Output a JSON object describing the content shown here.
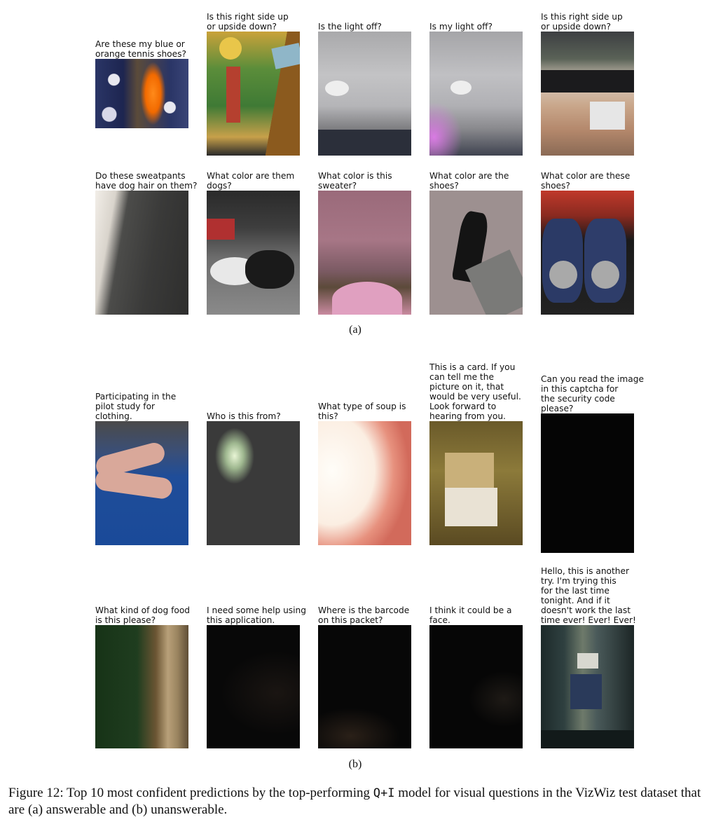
{
  "section_a": {
    "label": "(a)",
    "items": [
      {
        "question": "Are these my blue or\norange tennis shoes?",
        "image": "photo-blue-orange-shoes"
      },
      {
        "question": "Is this right side up\nor upside down?",
        "image": "photo-tarot-card"
      },
      {
        "question": "Is the light off?",
        "image": "photo-ceiling-fan"
      },
      {
        "question": "Is my light off?",
        "image": "photo-ceiling-fan-purple"
      },
      {
        "question": "Is this right side up\nor upside down?",
        "image": "photo-card-reader"
      },
      {
        "question": "Do these sweatpants\nhave dog hair on them?",
        "image": "photo-sweatpants"
      },
      {
        "question": "What color are them\ndogs?",
        "image": "photo-dogs"
      },
      {
        "question": "What color is this\nsweater?",
        "image": "photo-sweater"
      },
      {
        "question": "What color are the\nshoes?",
        "image": "photo-black-shoe"
      },
      {
        "question": "What color are these\nshoes?",
        "image": "photo-slippers"
      }
    ]
  },
  "section_b": {
    "label": "(b)",
    "items": [
      {
        "question": "Participating in the\npilot study for\nclothing.",
        "image": "photo-hand-peace"
      },
      {
        "question": "Who is this from?",
        "image": "photo-blurry-glow"
      },
      {
        "question": "What type of soup is\nthis?",
        "image": "photo-overexposed-pink"
      },
      {
        "question": "This is a card. If you\ncan tell me the\npicture on it, that\nwould be very useful.\nLook forward to\nhearing from you.",
        "image": "photo-blurry-card"
      },
      {
        "question": "Can you read the image\nin this captcha for\nthe security code\nplease?",
        "image": "photo-black"
      },
      {
        "question": "What kind of dog food\nis this please?",
        "image": "photo-blurry-green"
      },
      {
        "question": "I need some help using\nthis application.",
        "image": "photo-dark"
      },
      {
        "question": "Where is the barcode\non this packet?",
        "image": "photo-dark-2"
      },
      {
        "question": "I think it could be a\nface.",
        "image": "photo-dark-3"
      },
      {
        "question": "Hello, this is another\ntry. I'm trying this\nfor the last time\ntonight. And if it\ndoesn't work the last\ntime ever! Ever! Ever!",
        "image": "photo-hallway"
      }
    ]
  },
  "caption": {
    "prefix": "Figure 12: Top 10 most confident predictions by the top-performing ",
    "model": "Q+I",
    "suffix": " model for visual questions in the VizWiz test dataset that are (a) answerable and (b) unanswerable."
  }
}
